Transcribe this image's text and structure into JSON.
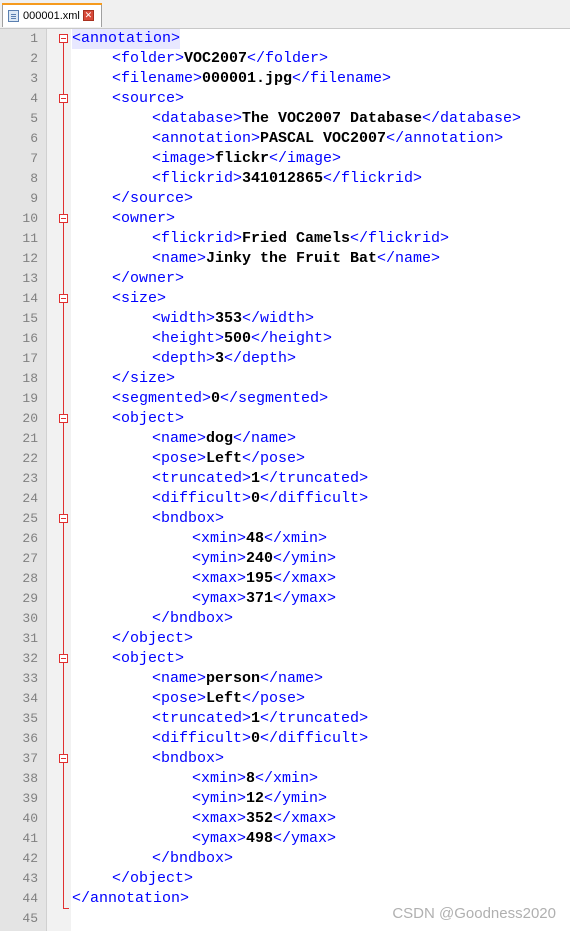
{
  "tab": {
    "filename": "000001.xml",
    "close_glyph": "✕"
  },
  "watermark": "CSDN @Goodness2020",
  "lines": [
    {
      "n": 1,
      "indent": 0,
      "open": "<annotation>",
      "fold": "start"
    },
    {
      "n": 2,
      "indent": 1,
      "open": "<folder>",
      "value": "VOC2007",
      "close": "</folder>"
    },
    {
      "n": 3,
      "indent": 1,
      "open": "<filename>",
      "value": "000001.jpg",
      "close": "</filename>"
    },
    {
      "n": 4,
      "indent": 1,
      "open": "<source>",
      "fold": "start"
    },
    {
      "n": 5,
      "indent": 2,
      "open": "<database>",
      "value": "The VOC2007 Database",
      "close": "</database>"
    },
    {
      "n": 6,
      "indent": 2,
      "open": "<annotation>",
      "value": "PASCAL VOC2007",
      "close": "</annotation>"
    },
    {
      "n": 7,
      "indent": 2,
      "open": "<image>",
      "value": "flickr",
      "close": "</image>"
    },
    {
      "n": 8,
      "indent": 2,
      "open": "<flickrid>",
      "value": "341012865",
      "close": "</flickrid>"
    },
    {
      "n": 9,
      "indent": 1,
      "close": "</source>"
    },
    {
      "n": 10,
      "indent": 1,
      "open": "<owner>",
      "fold": "start"
    },
    {
      "n": 11,
      "indent": 2,
      "open": "<flickrid>",
      "value": "Fried Camels",
      "close": "</flickrid>"
    },
    {
      "n": 12,
      "indent": 2,
      "open": "<name>",
      "value": "Jinky the Fruit Bat",
      "close": "</name>"
    },
    {
      "n": 13,
      "indent": 1,
      "close": "</owner>"
    },
    {
      "n": 14,
      "indent": 1,
      "open": "<size>",
      "fold": "start"
    },
    {
      "n": 15,
      "indent": 2,
      "open": "<width>",
      "value": "353",
      "close": "</width>"
    },
    {
      "n": 16,
      "indent": 2,
      "open": "<height>",
      "value": "500",
      "close": "</height>"
    },
    {
      "n": 17,
      "indent": 2,
      "open": "<depth>",
      "value": "3",
      "close": "</depth>"
    },
    {
      "n": 18,
      "indent": 1,
      "close": "</size>"
    },
    {
      "n": 19,
      "indent": 1,
      "open": "<segmented>",
      "value": "0",
      "close": "</segmented>"
    },
    {
      "n": 20,
      "indent": 1,
      "open": "<object>",
      "fold": "start"
    },
    {
      "n": 21,
      "indent": 2,
      "open": "<name>",
      "value": "dog",
      "close": "</name>"
    },
    {
      "n": 22,
      "indent": 2,
      "open": "<pose>",
      "value": "Left",
      "close": "</pose>"
    },
    {
      "n": 23,
      "indent": 2,
      "open": "<truncated>",
      "value": "1",
      "close": "</truncated>"
    },
    {
      "n": 24,
      "indent": 2,
      "open": "<difficult>",
      "value": "0",
      "close": "</difficult>"
    },
    {
      "n": 25,
      "indent": 2,
      "open": "<bndbox>",
      "fold": "start"
    },
    {
      "n": 26,
      "indent": 3,
      "open": "<xmin>",
      "value": "48",
      "close": "</xmin>"
    },
    {
      "n": 27,
      "indent": 3,
      "open": "<ymin>",
      "value": "240",
      "close": "</ymin>"
    },
    {
      "n": 28,
      "indent": 3,
      "open": "<xmax>",
      "value": "195",
      "close": "</xmax>"
    },
    {
      "n": 29,
      "indent": 3,
      "open": "<ymax>",
      "value": "371",
      "close": "</ymax>"
    },
    {
      "n": 30,
      "indent": 2,
      "close": "</bndbox>"
    },
    {
      "n": 31,
      "indent": 1,
      "close": "</object>"
    },
    {
      "n": 32,
      "indent": 1,
      "open": "<object>",
      "fold": "start"
    },
    {
      "n": 33,
      "indent": 2,
      "open": "<name>",
      "value": "person",
      "close": "</name>"
    },
    {
      "n": 34,
      "indent": 2,
      "open": "<pose>",
      "value": "Left",
      "close": "</pose>"
    },
    {
      "n": 35,
      "indent": 2,
      "open": "<truncated>",
      "value": "1",
      "close": "</truncated>"
    },
    {
      "n": 36,
      "indent": 2,
      "open": "<difficult>",
      "value": "0",
      "close": "</difficult>"
    },
    {
      "n": 37,
      "indent": 2,
      "open": "<bndbox>",
      "fold": "start"
    },
    {
      "n": 38,
      "indent": 3,
      "open": "<xmin>",
      "value": "8",
      "close": "</xmin>"
    },
    {
      "n": 39,
      "indent": 3,
      "open": "<ymin>",
      "value": "12",
      "close": "</ymin>"
    },
    {
      "n": 40,
      "indent": 3,
      "open": "<xmax>",
      "value": "352",
      "close": "</xmax>"
    },
    {
      "n": 41,
      "indent": 3,
      "open": "<ymax>",
      "value": "498",
      "close": "</ymax>"
    },
    {
      "n": 42,
      "indent": 2,
      "close": "</bndbox>"
    },
    {
      "n": 43,
      "indent": 1,
      "close": "</object>"
    },
    {
      "n": 44,
      "indent": 0,
      "close": "</annotation>",
      "fold": "end"
    },
    {
      "n": 45,
      "indent": 0
    }
  ]
}
